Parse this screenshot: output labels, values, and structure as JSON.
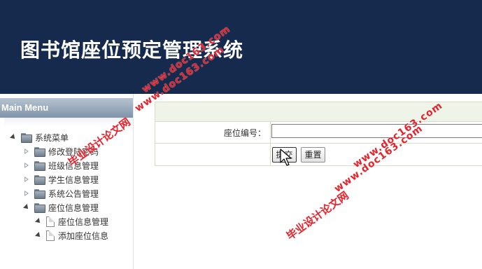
{
  "header": {
    "title": "图书馆座位预定管理系统"
  },
  "sidebar": {
    "menu_title": "Main Menu",
    "tree": {
      "root_label": "系统菜单",
      "items": [
        {
          "label": "修改登陆密码"
        },
        {
          "label": "班级信息管理"
        },
        {
          "label": "学生信息管理"
        },
        {
          "label": "系统公告管理"
        },
        {
          "label": "座位信息管理",
          "children": [
            {
              "label": "座位信息管理"
            },
            {
              "label": "添加座位信息"
            }
          ]
        }
      ]
    }
  },
  "form": {
    "seat_number_label": "座位编号：",
    "seat_number_value": "",
    "submit_label": "提交",
    "reset_label": "重置"
  },
  "watermarks": {
    "cn": "毕业设计论文网",
    "url": "www.doc163.com"
  },
  "colors": {
    "header_bg": "#152a4d",
    "watermark": "#e8222a",
    "form_head_bg": "#eef4e8"
  }
}
